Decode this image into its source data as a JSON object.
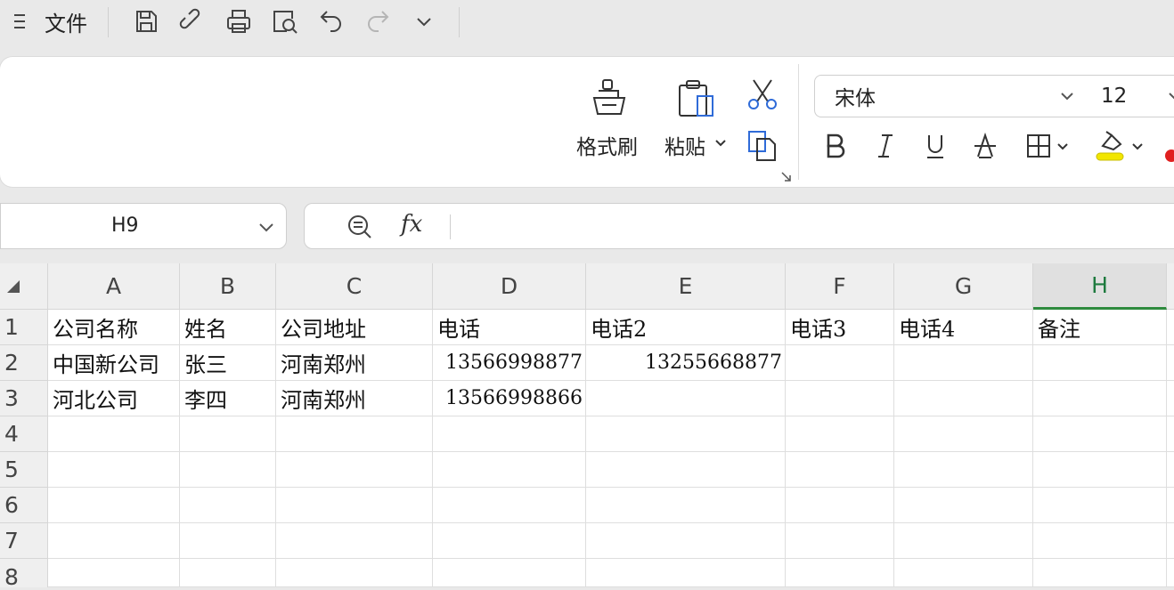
{
  "topbar": {
    "menu_icon": "menu-icon",
    "file_label": "文件",
    "icons": [
      "save-icon",
      "link-icon",
      "print-icon",
      "print-preview-icon",
      "undo-icon",
      "redo-icon",
      "chevron-down-icon"
    ]
  },
  "ribbon": {
    "format_painter_label": "格式刷",
    "paste_label": "粘贴",
    "font_name": "宋体",
    "font_size": "12",
    "highlight_color": "#f2e600",
    "font_color": "#e02020"
  },
  "formula_bar": {
    "name_box": "H9",
    "fx_label": "fx",
    "formula": ""
  },
  "sheet": {
    "columns": [
      "A",
      "B",
      "C",
      "D",
      "E",
      "F",
      "G",
      "H"
    ],
    "active_column": "H",
    "row_numbers": [
      "1",
      "2",
      "3",
      "4",
      "5",
      "6",
      "7",
      "8"
    ],
    "rows": [
      [
        "公司名称",
        "姓名",
        "公司地址",
        "电话",
        "电话2",
        "电话3",
        "电话4",
        "备注"
      ],
      [
        "中国新公司",
        "张三",
        "河南郑州",
        "13566998877",
        "13255668877",
        "",
        "",
        ""
      ],
      [
        "河北公司",
        "李四",
        "河南郑州",
        "13566998866",
        "",
        "",
        "",
        ""
      ],
      [
        "",
        "",
        "",
        "",
        "",
        "",
        "",
        ""
      ],
      [
        "",
        "",
        "",
        "",
        "",
        "",
        "",
        ""
      ],
      [
        "",
        "",
        "",
        "",
        "",
        "",
        "",
        ""
      ],
      [
        "",
        "",
        "",
        "",
        "",
        "",
        "",
        ""
      ],
      [
        "",
        "",
        "",
        "",
        "",
        "",
        "",
        ""
      ]
    ]
  }
}
